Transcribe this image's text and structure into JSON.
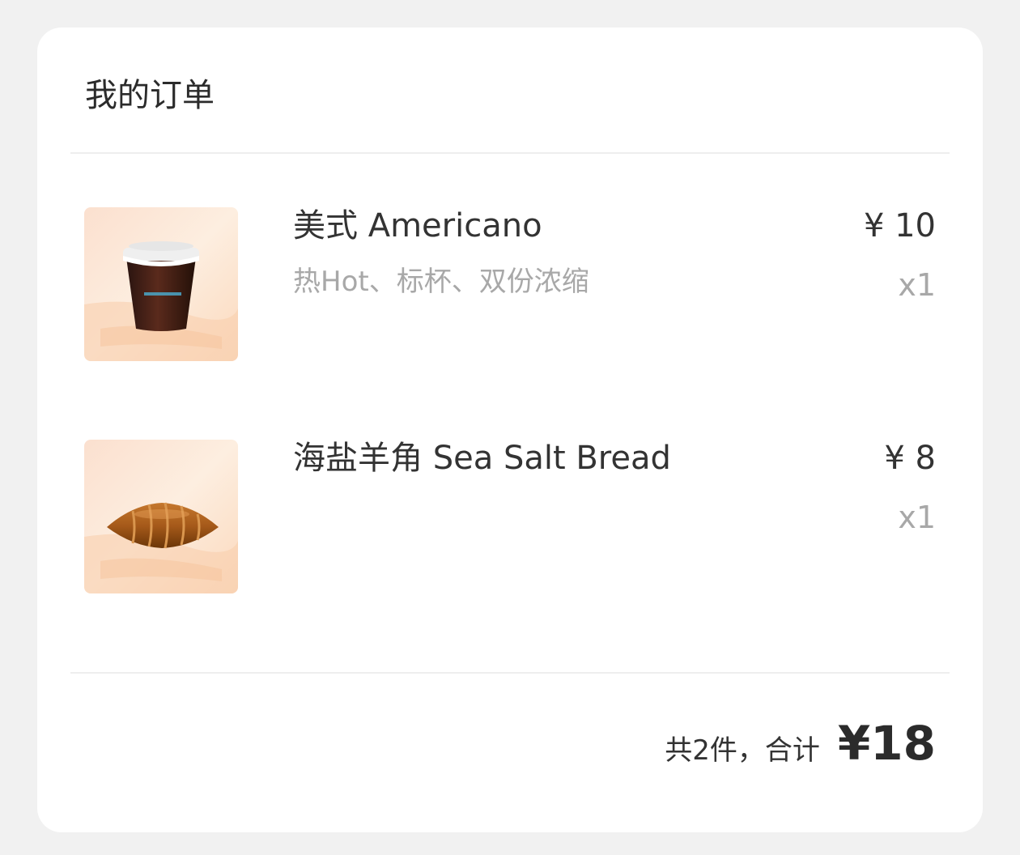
{
  "order": {
    "title": "我的订单",
    "items": [
      {
        "name": "美式 Americano",
        "options": "热Hot、标杯、双份浓缩",
        "price": "¥ 10",
        "quantity": "x1",
        "image_icon": "iced-americano-cup-image"
      },
      {
        "name": " 海盐羊角 Sea Salt Bread",
        "options": "",
        "price": "¥ 8",
        "quantity": "x1",
        "image_icon": "sea-salt-croissant-image"
      }
    ],
    "summary": {
      "label": "共2件，合计",
      "total": "¥18"
    }
  },
  "colors": {
    "background": "#f1f1f1",
    "card": "#ffffff",
    "text_primary": "#333333",
    "text_secondary": "#a8a8a8",
    "divider": "#eeeeee"
  }
}
